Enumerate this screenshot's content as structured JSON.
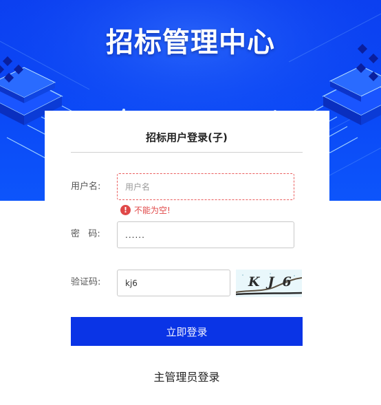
{
  "header": {
    "title": "招标管理中心"
  },
  "login": {
    "title": "招标用户登录(子)",
    "username": {
      "label": "用户名:",
      "placeholder": "用户名",
      "value": "",
      "error": "不能为空!"
    },
    "password": {
      "label": "密   码:",
      "value": "......"
    },
    "captcha": {
      "label": "验证码:",
      "value": "kj6",
      "image_text": "KJ6"
    },
    "submit_label": "立即登录",
    "admin_link": "主管理员登录"
  },
  "colors": {
    "banner_blue": "#0b3ff0",
    "button_blue": "#0a34e6",
    "error_red": "#e04848"
  },
  "icons": {
    "error": "exclamation-circle-icon"
  }
}
